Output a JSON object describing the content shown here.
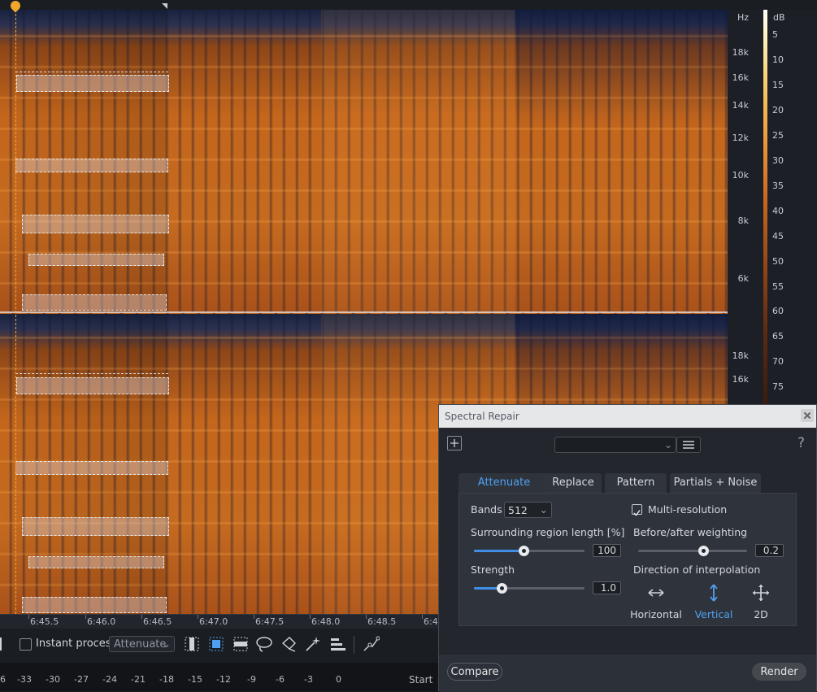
{
  "freq_axis": {
    "unit": "Hz",
    "top_ticks": [
      "18k",
      "16k",
      "14k",
      "12k",
      "10k",
      "8k",
      "6k"
    ],
    "bottom_ticks": [
      "18k",
      "16k"
    ]
  },
  "db_scale": {
    "unit": "dB",
    "ticks": [
      "5",
      "10",
      "15",
      "20",
      "25",
      "30",
      "35",
      "40",
      "45",
      "50",
      "55",
      "60",
      "65",
      "70",
      "75"
    ]
  },
  "time_ruler": {
    "labels": [
      "6:45.5",
      "6:46.0",
      "6:46.5",
      "6:47.0",
      "6:47.5",
      "6:48.0",
      "6:48.5",
      "6:4"
    ]
  },
  "toolbar": {
    "instant_process_label": "Instant process",
    "instant_process_checked": false,
    "mode_value": "Attenuate"
  },
  "meter": {
    "labels": [
      "6",
      "-33",
      "-30",
      "-27",
      "-24",
      "-21",
      "-18",
      "-15",
      "-12",
      "-9",
      "-6",
      "-3",
      "0"
    ],
    "start_label": "Start"
  },
  "dialog": {
    "title": "Spectral Repair",
    "preset_value": "",
    "help_label": "?",
    "tabs": [
      {
        "label": "Attenuate",
        "active": true
      },
      {
        "label": "Replace",
        "active": false
      },
      {
        "label": "Pattern",
        "active": false
      },
      {
        "label": "Partials + Noise",
        "active": false
      }
    ],
    "bands_label": "Bands",
    "bands_value": "512",
    "multi_resolution_label": "Multi-resolution",
    "multi_resolution_checked": true,
    "surrounding_label": "Surrounding region length [%]",
    "surrounding_value": "100",
    "surrounding_level": 0.45,
    "weighting_label": "Before/after weighting",
    "weighting_value": "0.2",
    "weighting_level": 0.6,
    "strength_label": "Strength",
    "strength_value": "1.0",
    "strength_level": 0.25,
    "direction_label": "Direction of interpolation",
    "directions": [
      {
        "label": "Horizontal",
        "icon": "horizontal-arrows-icon",
        "active": false
      },
      {
        "label": "Vertical",
        "icon": "vertical-arrows-icon",
        "active": true
      },
      {
        "label": "2D",
        "icon": "move-2d-icon",
        "active": false
      }
    ],
    "compare_label": "Compare",
    "render_label": "Render",
    "accent_color": "#4fa0f2"
  }
}
